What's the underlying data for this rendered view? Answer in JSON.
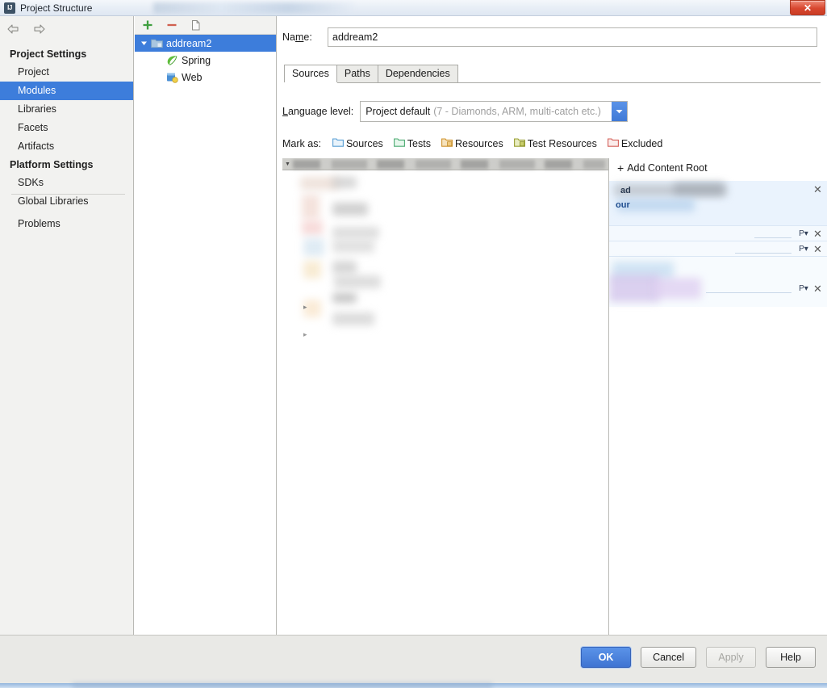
{
  "window": {
    "title": "Project Structure",
    "app_icon": "IJ",
    "close_label": "✕"
  },
  "sidebar": {
    "nav": {
      "back_icon": "arrow-left-icon",
      "forward_icon": "arrow-right-icon"
    },
    "groups": [
      {
        "title": "Project Settings",
        "items": [
          {
            "label": "Project",
            "selected": false
          },
          {
            "label": "Modules",
            "selected": true
          },
          {
            "label": "Libraries",
            "selected": false
          },
          {
            "label": "Facets",
            "selected": false
          },
          {
            "label": "Artifacts",
            "selected": false
          }
        ]
      },
      {
        "title": "Platform Settings",
        "items": [
          {
            "label": "SDKs",
            "selected": false
          },
          {
            "label": "Global Libraries",
            "selected": false
          }
        ]
      }
    ],
    "problems": {
      "label": "Problems"
    }
  },
  "tree_panel": {
    "toolbar": {
      "add_label": "+",
      "remove_label": "−",
      "copy_label": "copy-icon"
    },
    "nodes": [
      {
        "label": "addream2",
        "icon": "module-folder-icon",
        "selected": true,
        "expanded": true,
        "level": 0
      },
      {
        "label": "Spring",
        "icon": "spring-leaf-icon",
        "selected": false,
        "level": 1
      },
      {
        "label": "Web",
        "icon": "web-module-icon",
        "selected": false,
        "level": 1
      }
    ]
  },
  "editor": {
    "name_field": {
      "label": "Name:",
      "value": "addream2",
      "placeholder": ""
    },
    "tabs": [
      {
        "label": "Sources",
        "active": true
      },
      {
        "label": "Paths",
        "active": false
      },
      {
        "label": "Dependencies",
        "active": false
      }
    ],
    "language_level": {
      "label": "Language level:",
      "value": "Project default",
      "hint": "(7 - Diamonds, ARM, multi-catch etc.)",
      "arrow_icon": "chevron-down-icon"
    },
    "mark_as": {
      "label": "Mark as:",
      "options": [
        {
          "label": "Sources",
          "color": "#5a9fd4",
          "accent": "#cfe6f7"
        },
        {
          "label": "Tests",
          "color": "#4cab72",
          "accent": "#d6f0df"
        },
        {
          "label": "Resources",
          "color": "#d0942e",
          "accent": "#f6e2bb"
        },
        {
          "label": "Test Resources",
          "color": "#9aa033",
          "accent": "#e8ecc0"
        },
        {
          "label": "Excluded",
          "color": "#d4615a",
          "accent": "#f7d6d4"
        }
      ]
    },
    "content_roots": {
      "add_label": "Add Content Root",
      "add_icon": "plus-icon",
      "remove_icon": "close-icon",
      "prefix_icon": "package-prefix-icon",
      "entries": [
        {
          "remove_icon": "close-icon",
          "has_prefix": false
        },
        {
          "remove_icon": "close-icon",
          "has_prefix": true
        },
        {
          "remove_icon": "close-icon",
          "has_prefix": true
        },
        {
          "remove_icon": "close-icon",
          "has_prefix": true
        }
      ]
    }
  },
  "footer": {
    "buttons": [
      {
        "label": "OK",
        "style": "primary"
      },
      {
        "label": "Cancel",
        "style": "normal"
      },
      {
        "label": "Apply",
        "style": "disabled"
      },
      {
        "label": "Help",
        "style": "normal"
      }
    ]
  }
}
